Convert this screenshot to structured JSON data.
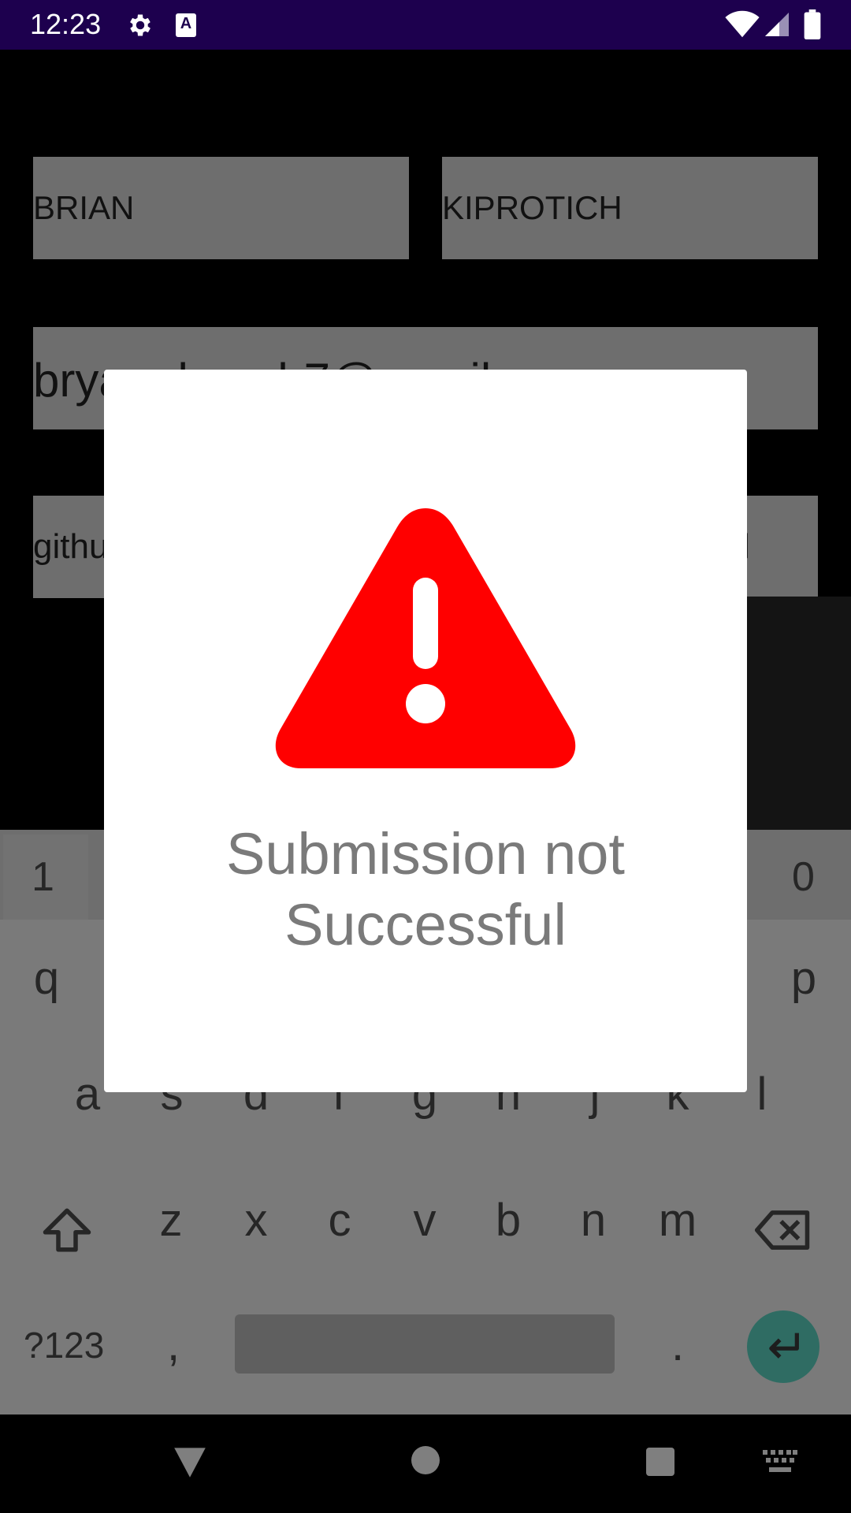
{
  "status_bar": {
    "time": "12:23",
    "icons": [
      "gear-icon",
      "a-icon",
      "wifi-icon",
      "signal-icon",
      "battery-icon"
    ],
    "background": "#1d004e"
  },
  "form": {
    "first_name": "BRIAN",
    "last_name": "KIPROTICH",
    "email": "bryannkoech7@gmail.com",
    "github_partial_left": "githu",
    "github_partial_right": "l"
  },
  "keyboard": {
    "number_row_visible": [
      "1",
      "0"
    ],
    "row1_visible": [
      "q",
      "p"
    ],
    "row2": [
      "a",
      "s",
      "d",
      "f",
      "g",
      "h",
      "j",
      "k",
      "l"
    ],
    "row3": [
      "z",
      "x",
      "c",
      "v",
      "b",
      "n",
      "m"
    ],
    "symbols_key": "?123",
    "comma": ",",
    "period": ".",
    "enter_color": "#2f6c63"
  },
  "dialog": {
    "message_line1": "Submission not",
    "message_line2": "Successful",
    "icon": "warning-icon",
    "icon_color": "#ff0000"
  },
  "nav_bar": {
    "icons": [
      "back-icon",
      "home-icon",
      "recents-icon",
      "keyboard-switch-icon"
    ]
  }
}
